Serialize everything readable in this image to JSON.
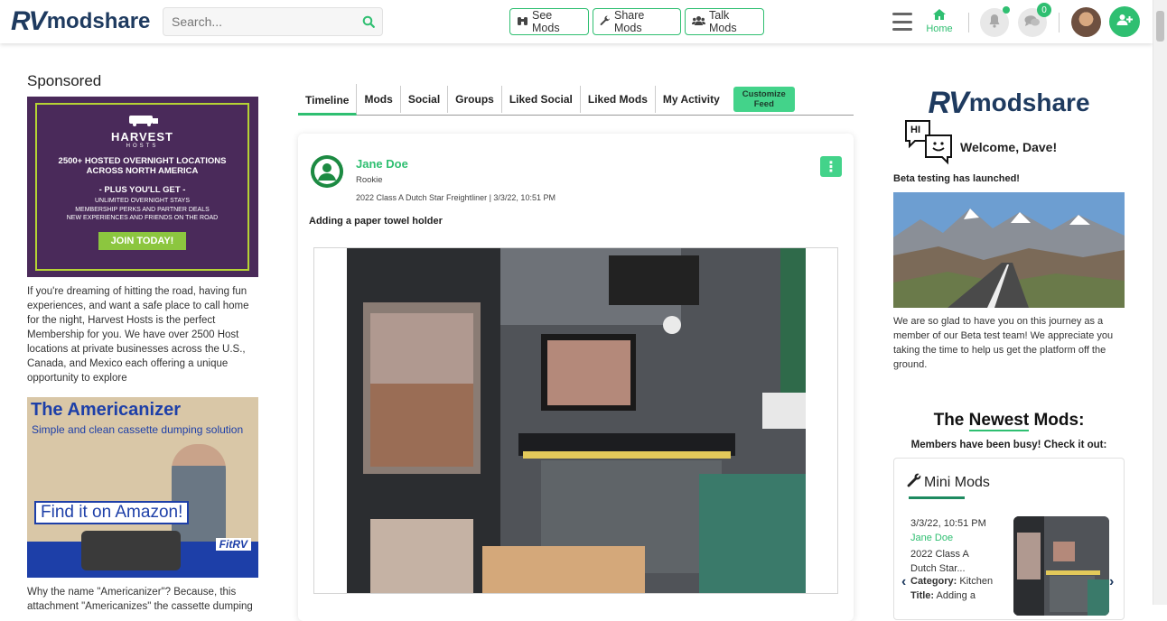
{
  "header": {
    "logo_rv": "RV",
    "logo_text": "modshare",
    "search_placeholder": "Search...",
    "nav": [
      {
        "label": "See Mods"
      },
      {
        "label": "Share Mods"
      },
      {
        "label": "Talk Mods"
      }
    ],
    "home_label": "Home",
    "messages_count": "0"
  },
  "sidebar_left": {
    "heading": "Sponsored",
    "ad1": {
      "brand": "HARVEST",
      "brand_sub": "HOSTS",
      "headline_1": "2500+ HOSTED OVERNIGHT LOCATIONS",
      "headline_2": "ACROSS NORTH AMERICA",
      "plus": "- PLUS YOU'LL GET -",
      "perk_1": "UNLIMITED OVERNIGHT STAYS",
      "perk_2": "MEMBERSHIP PERKS AND PARTNER DEALS",
      "perk_3": "NEW EXPERIENCES AND FRIENDS ON THE ROAD",
      "cta": "JOIN TODAY!",
      "description": "If you're dreaming of hitting the road, having fun experiences, and want a safe place to call home for the night, Harvest Hosts is the perfect Membership for you. We have over 2500 Host locations at private businesses across the U.S., Canada, and Mexico each offering a unique opportunity to explore"
    },
    "ad2": {
      "title": "The Americanizer",
      "subtitle": "Simple and clean cassette dumping solution",
      "amazon": "Find it on Amazon!",
      "brand": "FitRV",
      "description": "Why the name \"Americanizer\"? Because, this attachment \"Americanizes\" the cassette dumping"
    }
  },
  "feed": {
    "tabs": [
      {
        "label": "Timeline"
      },
      {
        "label": "Mods"
      },
      {
        "label": "Social"
      },
      {
        "label": "Groups"
      },
      {
        "label": "Liked Social"
      },
      {
        "label": "Liked Mods"
      },
      {
        "label": "My Activity"
      }
    ],
    "customize_label_1": "Customize",
    "customize_label_2": "Feed",
    "post": {
      "author": "Jane Doe",
      "rank": "Rookie",
      "meta": "2022 Class A Dutch Star Freightliner | 3/3/22, 10:51 PM",
      "text": "Adding a paper towel holder",
      "menu_icon": "⋮"
    }
  },
  "sidebar_right": {
    "logo_rv": "RV",
    "logo_text": "modshare",
    "bubble_text": "HI",
    "welcome": "Welcome, Dave!",
    "beta": "Beta testing has launched!",
    "body": "We are so glad to have you on this journey as a member of our Beta test team! We appreciate you taking the time to help us get the platform off the ground.",
    "newest_prefix": "The ",
    "newest_underlined": "Newest",
    "newest_suffix": " Mods:",
    "members": "Members have been busy! Check it out:",
    "mini": {
      "title": "Mini Mods",
      "date": "3/3/22, 10:51 PM",
      "author": "Jane Doe",
      "rv": "2022 Class A Dutch Star...",
      "category_label": "Category:",
      "category": "Kitchen",
      "title_label": "Title:",
      "title_value": "Adding a"
    }
  },
  "colors": {
    "accent": "#2fbf71",
    "brand_dark": "#1e3a5f"
  }
}
